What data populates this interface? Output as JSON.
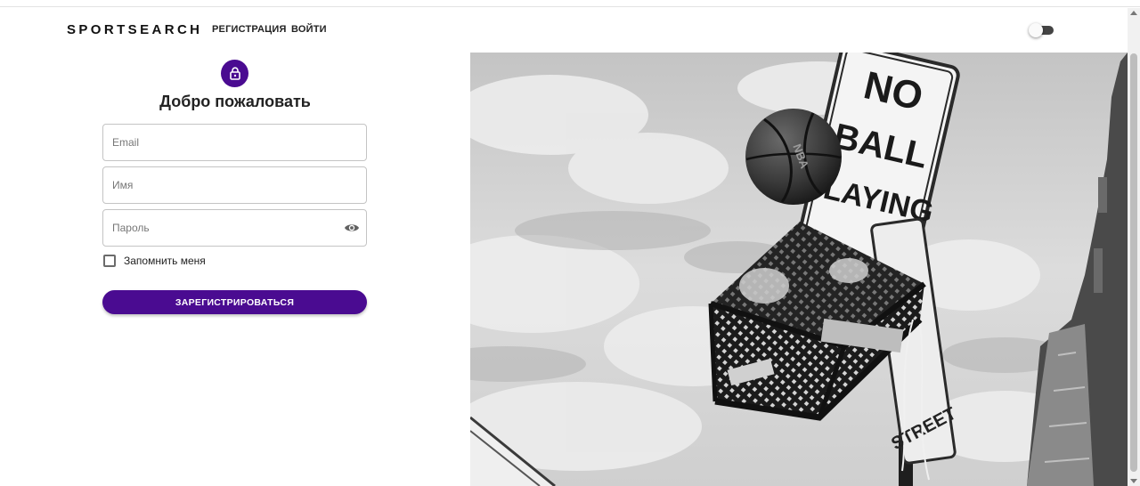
{
  "nav": {
    "brand": "SPORTSEARCH",
    "links": [
      {
        "label": "РЕГИСТРАЦИЯ"
      },
      {
        "label": "ВОЙТИ"
      }
    ],
    "theme_toggle": {
      "checked": false
    }
  },
  "form": {
    "title": "Добро пожаловать",
    "email_placeholder": "Email",
    "email_value": "",
    "name_placeholder": "Имя",
    "name_value": "",
    "password_placeholder": "Пароль",
    "password_value": "",
    "remember_label": "Запомнить меня",
    "remember_checked": false,
    "submit_label": "ЗАРЕГИСТРИРОВАТЬСЯ"
  },
  "image": {
    "sign_text": [
      "NO",
      "BALL",
      "PLAYING"
    ],
    "ball_text": "NBA",
    "street_sign_text": "STREET"
  },
  "colors": {
    "primary": "#4a0b91",
    "background": "#ffffff"
  },
  "icons": {
    "avatar": "lock-icon",
    "password_toggle": "eye-icon"
  }
}
